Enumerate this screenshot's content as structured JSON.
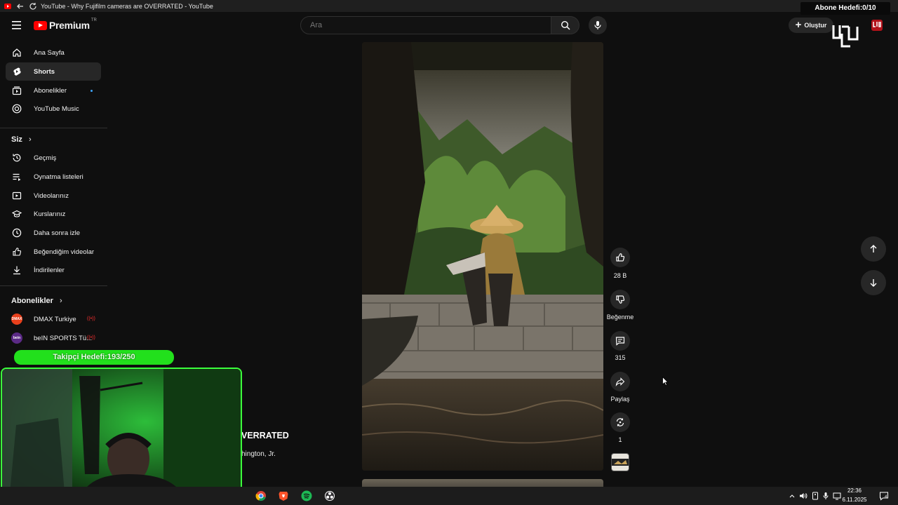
{
  "window": {
    "title": "YouTube - Why Fujifilm cameras are OVERRATED - YouTube"
  },
  "header": {
    "brand": "Premium",
    "country_code": "TR",
    "search_placeholder": "Ara",
    "create_label": "Oluştur"
  },
  "overlays": {
    "abone_hedefi": "Abone Hedefi:0/10",
    "takipci_hedefi": "Takipçi Hedefi:193/250",
    "video_title_partial": "VERRATED",
    "video_channel_partial": "hington, Jr."
  },
  "sidebar": {
    "main_items": [
      {
        "label": "Ana Sayfa",
        "icon": "home-icon"
      },
      {
        "label": "Shorts",
        "icon": "shorts-icon"
      },
      {
        "label": "Abonelikler",
        "icon": "subscriptions-icon"
      },
      {
        "label": "YouTube Music",
        "icon": "music-icon"
      }
    ],
    "you_title": "Siz",
    "you_items": [
      {
        "label": "Geçmiş",
        "icon": "history-icon"
      },
      {
        "label": "Oynatma listeleri",
        "icon": "playlists-icon"
      },
      {
        "label": "Videolarınız",
        "icon": "your-videos-icon"
      },
      {
        "label": "Kurslarınız",
        "icon": "courses-icon"
      },
      {
        "label": "Daha sonra izle",
        "icon": "watch-later-icon"
      },
      {
        "label": "Beğendiğim videolar",
        "icon": "liked-icon"
      },
      {
        "label": "İndirilenler",
        "icon": "download-icon"
      }
    ],
    "subs_title": "Abonelikler",
    "channels": [
      {
        "label": "DMAX Turkiye",
        "avatar": "DMAX",
        "color": "#e8401c"
      },
      {
        "label": "beIN SPORTS Tü...",
        "avatar": "bein",
        "color": "#5b2a86"
      }
    ]
  },
  "actions": {
    "like_count": "28 B",
    "dislike_label": "Beğenme",
    "comment_count": "315",
    "share_label": "Paylaş",
    "remix_count": "1"
  },
  "taskbar": {
    "time": "22:36",
    "date": "6.11.2025",
    "notifications": "4"
  },
  "colors": {
    "accent_red": "#ff0000",
    "overlay_green": "#22e01c",
    "webcam_border": "#3cff3c"
  }
}
